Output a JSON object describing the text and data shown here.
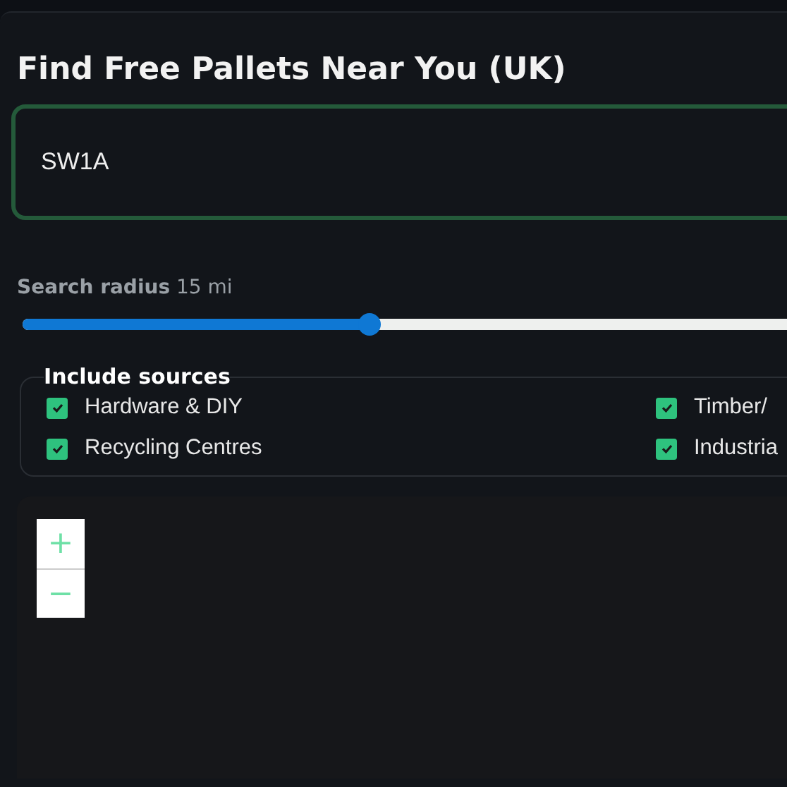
{
  "title": "Find Free Pallets Near You (UK)",
  "postcode": {
    "value": "SW1A"
  },
  "radius": {
    "label": "Search radius",
    "reading": "15 mi",
    "level": 0.405
  },
  "sources": {
    "legend": "Include sources",
    "items": [
      {
        "label": "Hardware & DIY",
        "checked": true
      },
      {
        "label": "Timber/",
        "checked": true
      },
      {
        "label": "Recycling Centres",
        "checked": true
      },
      {
        "label": "Industria",
        "checked": true
      }
    ]
  },
  "map": {
    "zoom_in": "+",
    "zoom_out": "−"
  }
}
